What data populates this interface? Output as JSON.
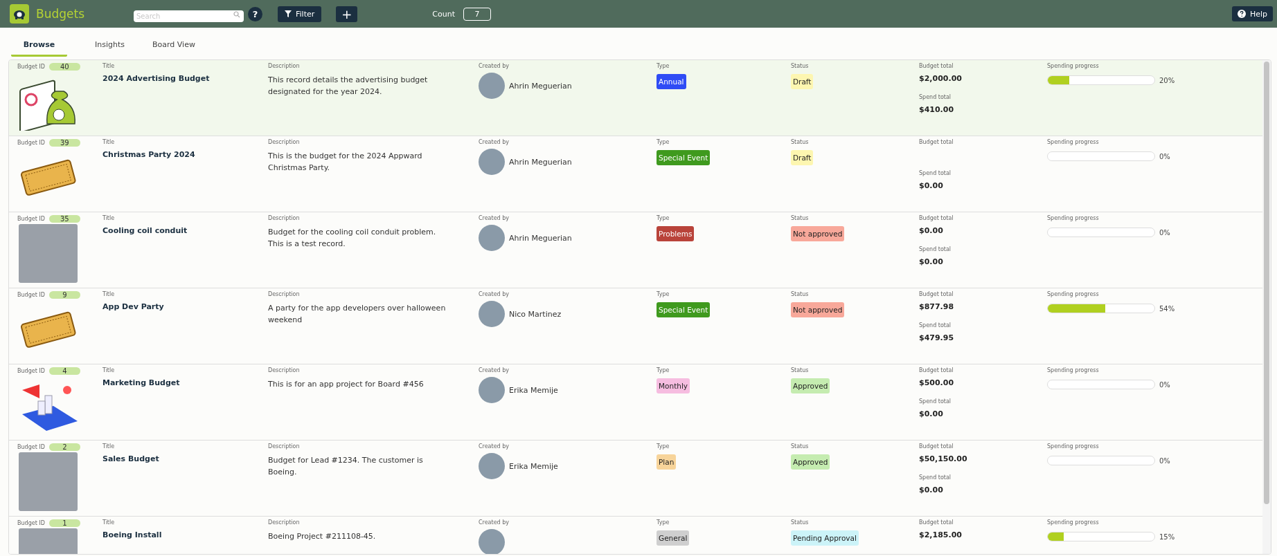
{
  "app": {
    "title": "Budgets"
  },
  "toolbar": {
    "search_placeholder": "Search",
    "help_glyph": "?",
    "filter_label": "Filter",
    "add_glyph": "+",
    "count_label": "Count",
    "count_value": "7",
    "help_label": "Help"
  },
  "tabs": [
    {
      "label": "Browse",
      "selected": true
    },
    {
      "label": "Insights",
      "selected": false
    },
    {
      "label": "Board View",
      "selected": false
    }
  ],
  "rows": [
    {
      "selected": true,
      "kind": "money",
      "labels": {
        "id": "Budget ID",
        "title": "Title",
        "description": "Description",
        "created_by": "Created by",
        "type": "Type",
        "status": "Status",
        "budget_total": "Budget total",
        "spend_total": "Spend total",
        "progress": "Spending progress"
      },
      "id": "40",
      "title": "2024 Advertising Budget",
      "description": "This record details the advertising budget designated for the year 2024.",
      "created_by": "Ahrin Meguerian",
      "type": {
        "label": "Annual",
        "color": "#2f4cf5"
      },
      "status": {
        "label": "Draft",
        "color": "#fdf6b0"
      },
      "budget_total": "$2,000.00",
      "spend_total": "$410.00",
      "level": 0.2,
      "percent": "20%"
    },
    {
      "selected": false,
      "kind": "ticket",
      "labels": {
        "id": "Budget ID",
        "title": "Title",
        "description": "Description",
        "created_by": "Created by",
        "type": "Type",
        "status": "Status",
        "budget_total": "Budget total",
        "spend_total": "Spend total",
        "progress": "Spending progress"
      },
      "id": "39",
      "title": "Christmas Party 2024",
      "description": "This is the budget for the 2024 Appward Christmas Party.",
      "created_by": "Ahrin Meguerian",
      "type": {
        "label": "Special Event",
        "color": "#3f9a1e"
      },
      "status": {
        "label": "Draft",
        "color": "#fdf6b0"
      },
      "spend_total": "$0.00",
      "level": 0,
      "percent": "0%"
    },
    {
      "selected": false,
      "kind": "photo",
      "labels": {
        "id": "Budget ID",
        "title": "Title",
        "description": "Description",
        "created_by": "Created by",
        "type": "Type",
        "status": "Status",
        "budget_total": "Budget total",
        "spend_total": "Spend total",
        "progress": "Spending progress"
      },
      "id": "35",
      "title": "Cooling coil conduit",
      "description": "Budget for the cooling coil conduit problem. This is a test record.",
      "created_by": "Ahrin Meguerian",
      "type": {
        "label": "Problems",
        "color": "#b9433a"
      },
      "status": {
        "label": "Not approved",
        "color": "#f8a89a"
      },
      "budget_total": "$0.00",
      "spend_total": "$0.00",
      "level": 0,
      "percent": "0%"
    },
    {
      "selected": false,
      "kind": "ticket",
      "labels": {
        "id": "Budget ID",
        "title": "Title",
        "description": "Description",
        "created_by": "Created by",
        "type": "Type",
        "status": "Status",
        "budget_total": "Budget total",
        "spend_total": "Spend total",
        "progress": "Spending progress"
      },
      "id": "9",
      "title": "App Dev Party",
      "description": "A party for the app developers over halloween weekend",
      "created_by": "Nico Martinez",
      "type": {
        "label": "Special Event",
        "color": "#3f9a1e"
      },
      "status": {
        "label": "Not approved",
        "color": "#f8a89a"
      },
      "budget_total": "$877.98",
      "spend_total": "$479.95",
      "level": 0.54,
      "percent": "54%"
    },
    {
      "selected": false,
      "kind": "marketing",
      "labels": {
        "id": "Budget ID",
        "title": "Title",
        "description": "Description",
        "created_by": "Created by",
        "type": "Type",
        "status": "Status",
        "budget_total": "Budget total",
        "spend_total": "Spend total",
        "progress": "Spending progress"
      },
      "id": "4",
      "title": "Marketing Budget",
      "description": "This is for an app project for Board #456",
      "created_by": "Erika Memije",
      "type": {
        "label": "Monthly",
        "color": "#f6bde0"
      },
      "status": {
        "label": "Approved",
        "color": "#c5ecb0"
      },
      "budget_total": "$500.00",
      "spend_total": "$0.00",
      "level": 0,
      "percent": "0%"
    },
    {
      "selected": false,
      "kind": "photo",
      "labels": {
        "id": "Budget ID",
        "title": "Title",
        "description": "Description",
        "created_by": "Created by",
        "type": "Type",
        "status": "Status",
        "budget_total": "Budget total",
        "spend_total": "Spend total",
        "progress": "Spending progress"
      },
      "id": "2",
      "title": "Sales Budget",
      "description": "Budget for Lead #1234. The customer is Boeing.",
      "created_by": "Erika Memije",
      "type": {
        "label": "Plan",
        "color": "#f7d49a"
      },
      "status": {
        "label": "Approved",
        "color": "#c5ecb0"
      },
      "budget_total": "$50,150.00",
      "spend_total": "$0.00",
      "level": 0,
      "percent": "0%"
    },
    {
      "selected": false,
      "kind": "photo",
      "labels": {
        "id": "Budget ID",
        "title": "Title",
        "description": "Description",
        "created_by": "Created by",
        "type": "Type",
        "status": "Status",
        "budget_total": "Budget total",
        "progress": "Spending progress"
      },
      "id": "1",
      "title": "Boeing Install",
      "description": "Boeing Project #211108-45.",
      "type": {
        "label": "General",
        "color": "#cfcfcf"
      },
      "status": {
        "label": "Pending Approval",
        "color": "#ccf3f8"
      },
      "budget_total": "$2,185.00",
      "level": 0.15,
      "percent": "15%"
    }
  ]
}
